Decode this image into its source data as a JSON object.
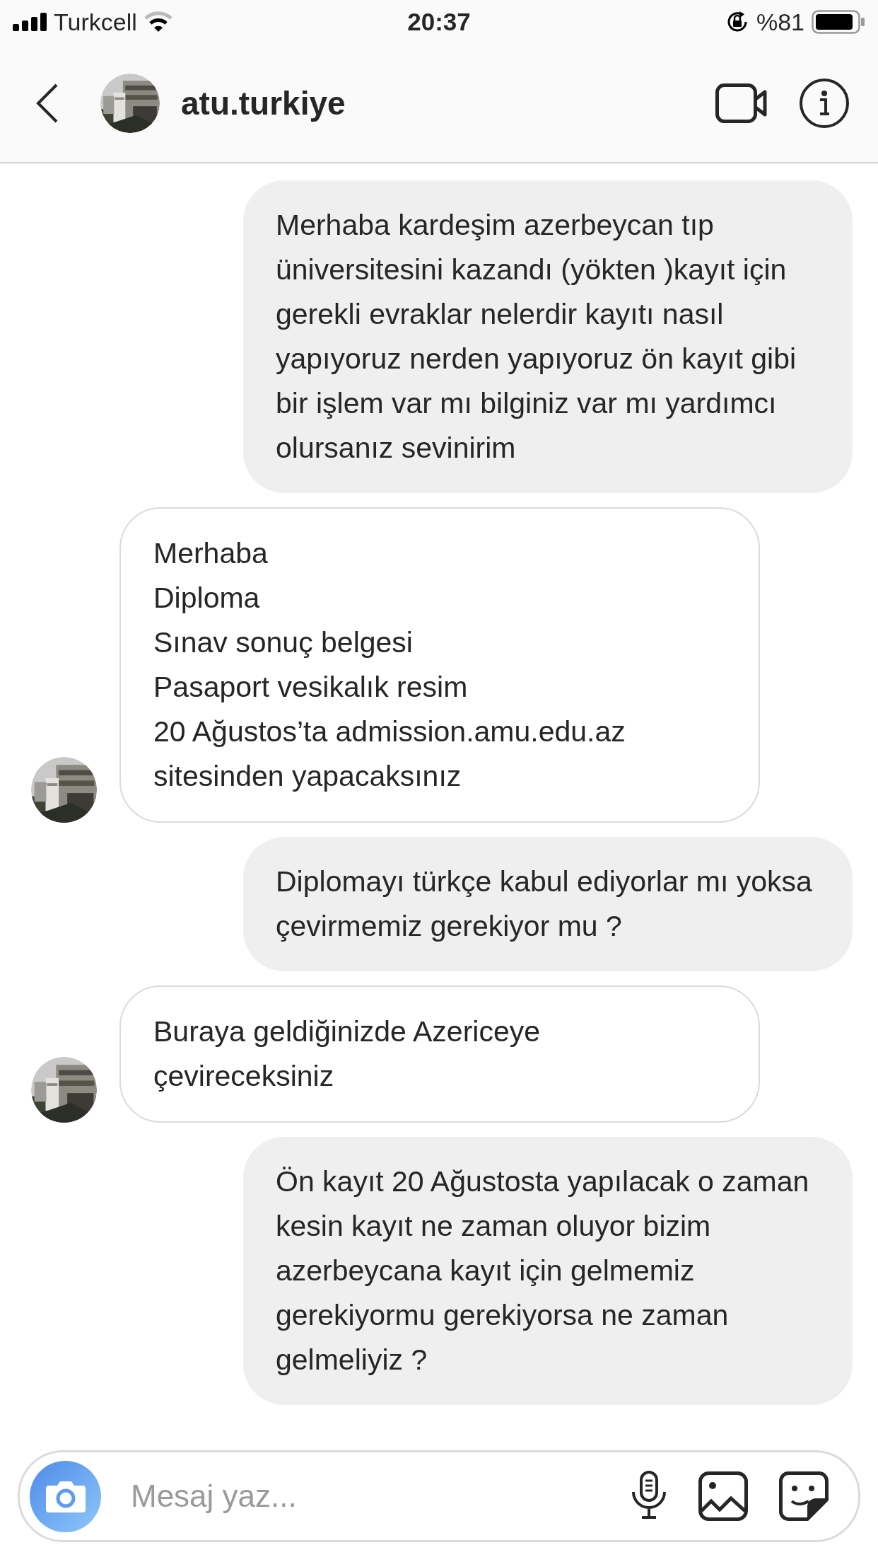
{
  "status_bar": {
    "carrier": "Turkcell",
    "time": "20:37",
    "battery": "%81"
  },
  "header": {
    "username": "atu.turkiye"
  },
  "messages": [
    {
      "kind": "sent",
      "text": "Merhaba kardeşim azerbeycan tıp üniversitesini kazandı (yökten )kayıt için gerekli evraklar nelerdir kayıtı nasıl yapıyoruz nerden yapıyoruz ön kayıt gibi bir işlem var mı bilginiz var mı yardımcı olursanız sevinirim"
    },
    {
      "kind": "received",
      "text": "Merhaba\nDiploma\nSınav sonuç belgesi\nPasaport vesikalık resim\n20 Ağustos’ta admission.amu.edu.az sitesinden yapacaksınız"
    },
    {
      "kind": "sent",
      "text": "Diplomayı türkçe kabul ediyorlar mı yoksa çevirmemiz gerekiyor mu ?"
    },
    {
      "kind": "received",
      "text": "Buraya geldiğinizde Azericeye çevireceksiniz"
    },
    {
      "kind": "sent",
      "text": "Ön kayıt 20 Ağustosta yapılacak o zaman kesin kayıt ne zaman oluyor bizim azerbeycana kayıt için gelmemiz gerekiyormu gerekiyorsa ne zaman gelmeliyiz ?"
    }
  ],
  "composer": {
    "placeholder": "Mesaj yaz..."
  }
}
